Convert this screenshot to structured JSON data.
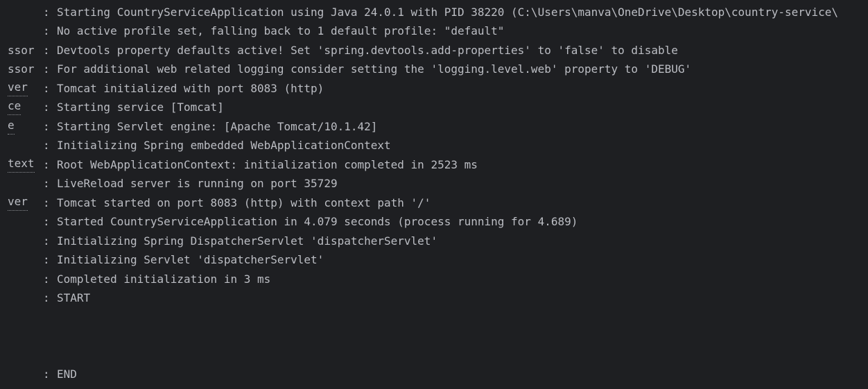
{
  "console": {
    "separator": ":",
    "lines": [
      {
        "logger": "",
        "message": "Starting CountryServiceApplication using Java 24.0.1 with PID 38220 (C:\\Users\\manva\\OneDrive\\Desktop\\country-service\\"
      },
      {
        "logger": "",
        "message": "No active profile set, falling back to 1 default profile: \"default\""
      },
      {
        "logger": "ssor",
        "message": "Devtools property defaults active! Set 'spring.devtools.add-properties' to 'false' to disable"
      },
      {
        "logger": "ssor",
        "message": "For additional web related logging consider setting the 'logging.level.web' property to 'DEBUG'"
      },
      {
        "logger": "ver",
        "message": "Tomcat initialized with port 8083 (http)"
      },
      {
        "logger": "ce",
        "message": "Starting service [Tomcat]"
      },
      {
        "logger": "e",
        "message": "Starting Servlet engine: [Apache Tomcat/10.1.42]"
      },
      {
        "logger": "",
        "message": "Initializing Spring embedded WebApplicationContext"
      },
      {
        "logger": "text",
        "message": "Root WebApplicationContext: initialization completed in 2523 ms"
      },
      {
        "logger": "",
        "message": "LiveReload server is running on port 35729"
      },
      {
        "logger": "ver",
        "message": "Tomcat started on port 8083 (http) with context path '/'"
      },
      {
        "logger": "",
        "message": "Started CountryServiceApplication in 4.079 seconds (process running for 4.689)"
      },
      {
        "logger": "",
        "message": "Initializing Spring DispatcherServlet 'dispatcherServlet'"
      },
      {
        "logger": "",
        "message": "Initializing Servlet 'dispatcherServlet'"
      },
      {
        "logger": "",
        "message": "Completed initialization in 3 ms"
      },
      {
        "logger": "",
        "message": "START"
      },
      {
        "logger": "",
        "message": "END"
      }
    ]
  }
}
